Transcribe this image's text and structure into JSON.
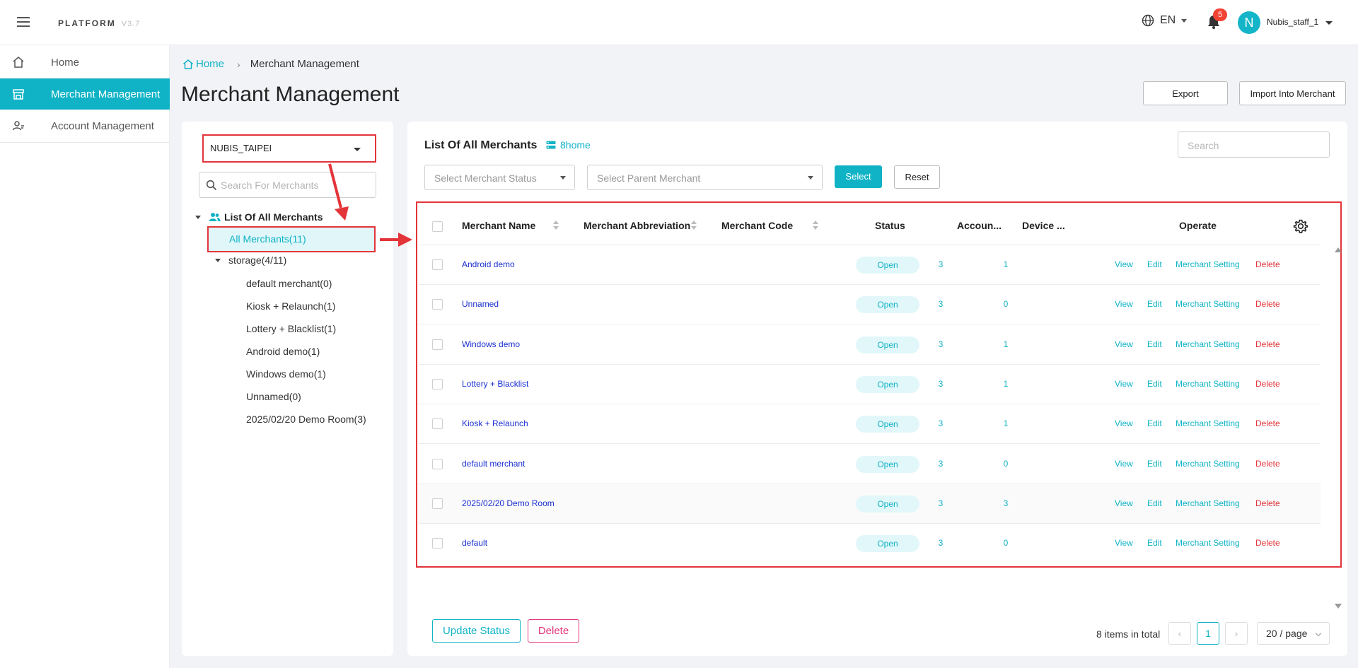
{
  "header": {
    "brand": "PLATFORM",
    "version": "V3.7",
    "language": "EN",
    "notifications_count": "5",
    "avatar_initial": "N",
    "username": "Nubis_staff_1"
  },
  "sidebar": {
    "items": [
      {
        "label": "Home",
        "icon": "home-icon"
      },
      {
        "label": "Merchant Management",
        "icon": "store-icon",
        "active": true
      },
      {
        "label": "Account Management",
        "icon": "users-icon"
      }
    ]
  },
  "breadcrumb": {
    "home": "Home",
    "current": "Merchant Management"
  },
  "page": {
    "title": "Merchant Management",
    "export_label": "Export",
    "import_label": "Import Into Merchant"
  },
  "tree": {
    "tenant": "NUBIS_TAIPEI",
    "search_placeholder": "Search For Merchants",
    "root_label": "List Of All Merchants",
    "all_label": "All Merchants(11)",
    "group_label": "storage(4/11)",
    "nodes": [
      "default merchant(0)",
      "Kiosk + Relaunch(1)",
      "Lottery + Blacklist(1)",
      "Android demo(1)",
      "Windows demo(1)",
      "Unnamed(0)",
      "2025/02/20 Demo Room(3)"
    ]
  },
  "list": {
    "title": "List Of All Merchants",
    "branch": "8home",
    "search_placeholder": "Search",
    "status_placeholder": "Select Merchant Status",
    "parent_placeholder": "Select Parent Merchant",
    "select_label": "Select",
    "reset_label": "Reset",
    "columns": {
      "name": "Merchant Name",
      "abbr": "Merchant Abbreviation",
      "code": "Merchant Code",
      "status": "Status",
      "accounts": "Accoun...",
      "devices": "Device ...",
      "operate": "Operate"
    },
    "actions": {
      "view": "View",
      "edit": "Edit",
      "setting": "Merchant Setting",
      "delete": "Delete"
    },
    "rows": [
      {
        "name": "Android demo",
        "status": "Open",
        "accounts": "3",
        "devices": "1"
      },
      {
        "name": "Unnamed",
        "status": "Open",
        "accounts": "3",
        "devices": "0"
      },
      {
        "name": "Windows demo",
        "status": "Open",
        "accounts": "3",
        "devices": "1"
      },
      {
        "name": "Lottery + Blacklist",
        "status": "Open",
        "accounts": "3",
        "devices": "1"
      },
      {
        "name": "Kiosk + Relaunch",
        "status": "Open",
        "accounts": "3",
        "devices": "1"
      },
      {
        "name": "default merchant",
        "status": "Open",
        "accounts": "3",
        "devices": "0"
      },
      {
        "name": "2025/02/20 Demo Room",
        "status": "Open",
        "accounts": "3",
        "devices": "3"
      },
      {
        "name": "default",
        "status": "Open",
        "accounts": "3",
        "devices": "0"
      }
    ]
  },
  "footer": {
    "update_status_label": "Update Status",
    "delete_label": "Delete",
    "total": "8 items in total",
    "current_page": "1",
    "page_size": "20 / page"
  },
  "colors": {
    "accent": "#10b3c6",
    "annotation": "#e3343a",
    "link": "#1a2fd1"
  }
}
